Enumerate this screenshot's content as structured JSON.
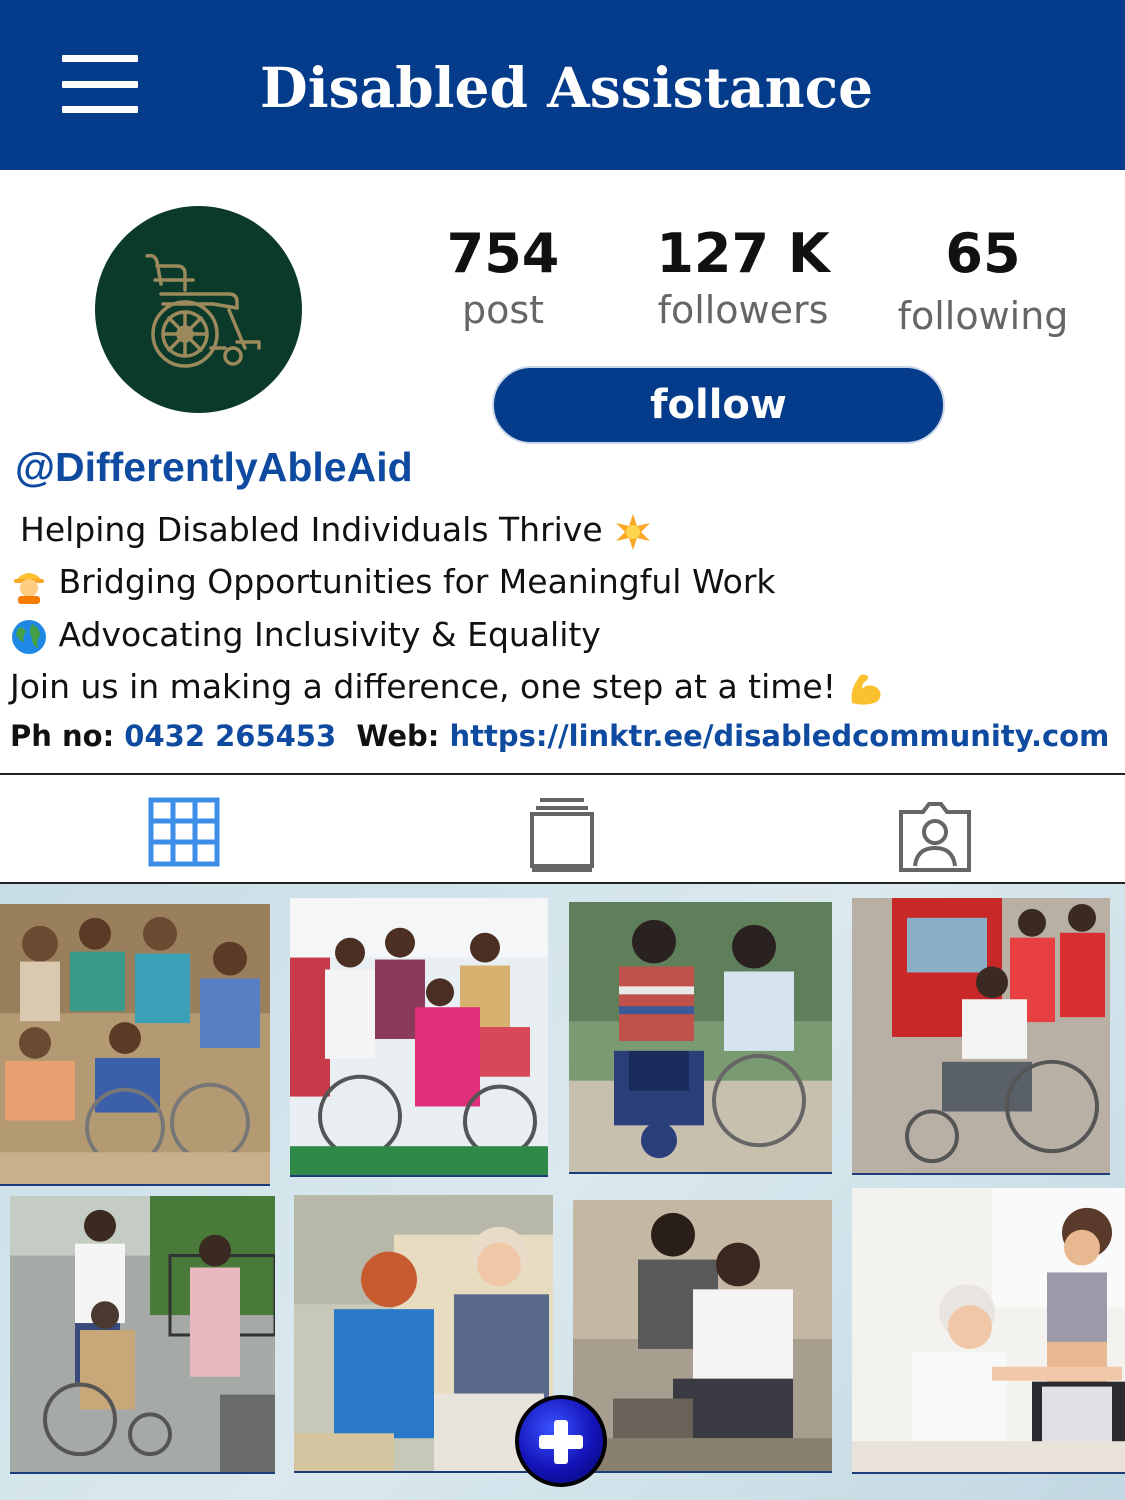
{
  "app": {
    "title": "Disabled Assistance"
  },
  "profile": {
    "stats": [
      {
        "value": "754",
        "label": "post"
      },
      {
        "value": "127 K",
        "label": "followers"
      },
      {
        "value": "65",
        "label": "following"
      }
    ],
    "follow_label": "follow",
    "handle": "@DifferentlyAbleAid",
    "bio": [
      "Helping Disabled Individuals Thrive",
      "Bridging Opportunities for Meaningful Work",
      "Advocating Inclusivity & Equality",
      "Join us in making a difference, one step at a time!"
    ],
    "contact": {
      "phone_label": "Ph no:",
      "phone": "0432 265453",
      "web_label": "Web:",
      "web": "https://linktr.ee/disabledcommunity.com"
    }
  },
  "tabs": [
    {
      "icon": "grid-icon",
      "active": true
    },
    {
      "icon": "feed-icon",
      "active": false
    },
    {
      "icon": "tagged-icon",
      "active": false
    }
  ],
  "colors": {
    "brand": "#043b8a",
    "link": "#0d4aa0",
    "active_tab": "#3c8ee8",
    "inactive_tab": "#666666",
    "avatar_bg": "#0b3a2b"
  },
  "posts": [
    {
      "icon": "group-photo"
    },
    {
      "icon": "tricycle-photo"
    },
    {
      "icon": "scooter-photo"
    },
    {
      "icon": "wheelchair-photo"
    },
    {
      "icon": "street-wheelchair-photo"
    },
    {
      "icon": "caregiver-photo"
    },
    {
      "icon": "helper-photo"
    },
    {
      "icon": "exercise-photo"
    }
  ]
}
